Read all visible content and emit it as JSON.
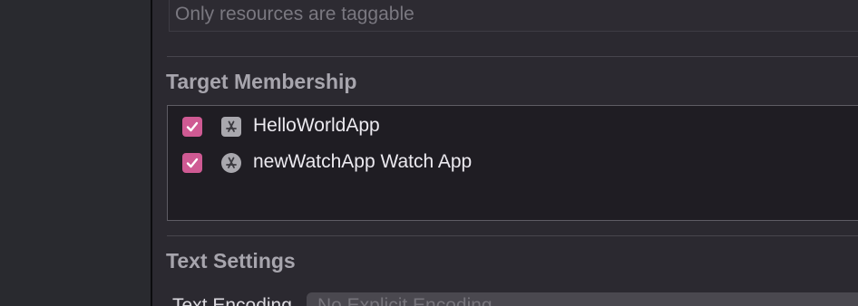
{
  "tags": {
    "placeholder": "Only resources are taggable"
  },
  "target_membership": {
    "title": "Target Membership",
    "targets": [
      {
        "label": "HelloWorldApp",
        "checked": true,
        "icon": "app-store-icon"
      },
      {
        "label": "newWatchApp Watch App",
        "checked": true,
        "icon": "watch-app-icon"
      }
    ]
  },
  "text_settings": {
    "title": "Text Settings",
    "encoding_label": "Text Encoding",
    "encoding_value": "No Explicit Encoding"
  },
  "colors": {
    "checkbox_accent": "#cf5a93",
    "panel_background": "#2b2930",
    "list_background": "#1f1d23"
  }
}
